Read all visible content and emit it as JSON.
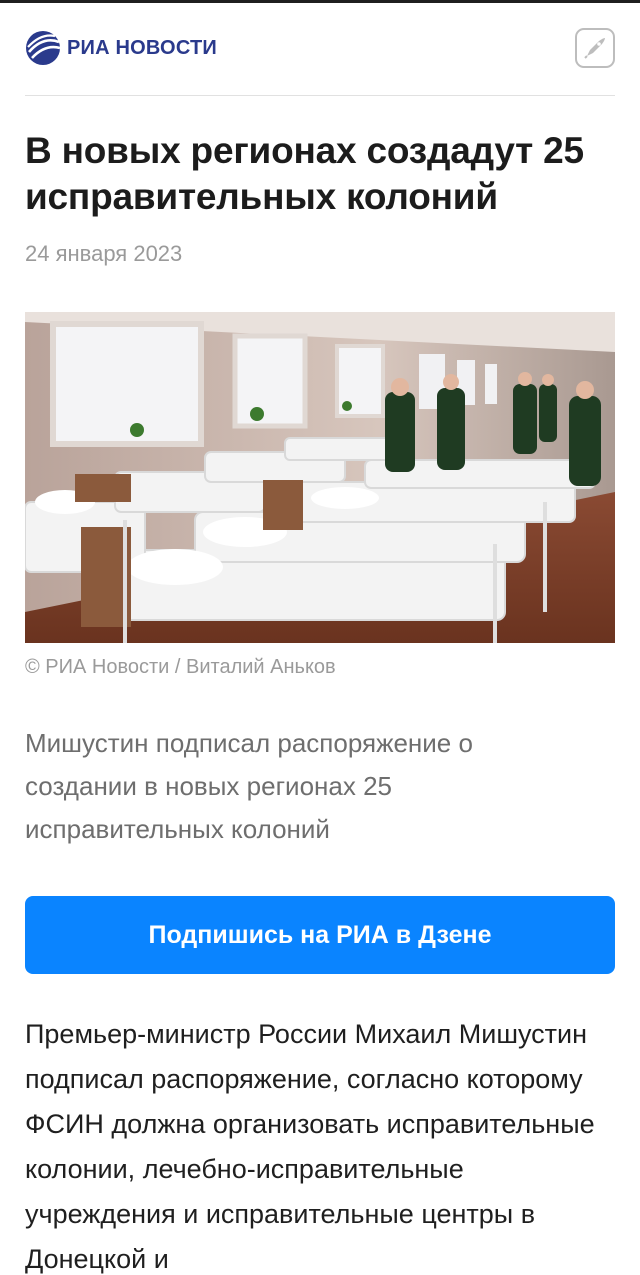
{
  "header": {
    "logo_text": "РИА НОВОСТИ",
    "brand_color": "#2a3a8c",
    "share_icon": "rocket-icon"
  },
  "article": {
    "title": "В новых регионах создадут 25 исправительных колоний",
    "date": "24 января 2023",
    "photo_caption": "© РИА Новости / Виталий Аньков",
    "lead": "Мишустин подписал распоряжение о создании в новых регионах 25 исправительных колоний",
    "subscribe_button": "Подпишись на РИА в Дзене",
    "body": "Премьер-министр России Михаил Мишустин подписал распоряжение, согласно которому ФСИН должна организовать исправительные колонии, лечебно-исправительные учреждения и исправительные центры в Донецкой и"
  },
  "colors": {
    "accent": "#0a84ff",
    "muted_text": "#9a9a9a"
  }
}
